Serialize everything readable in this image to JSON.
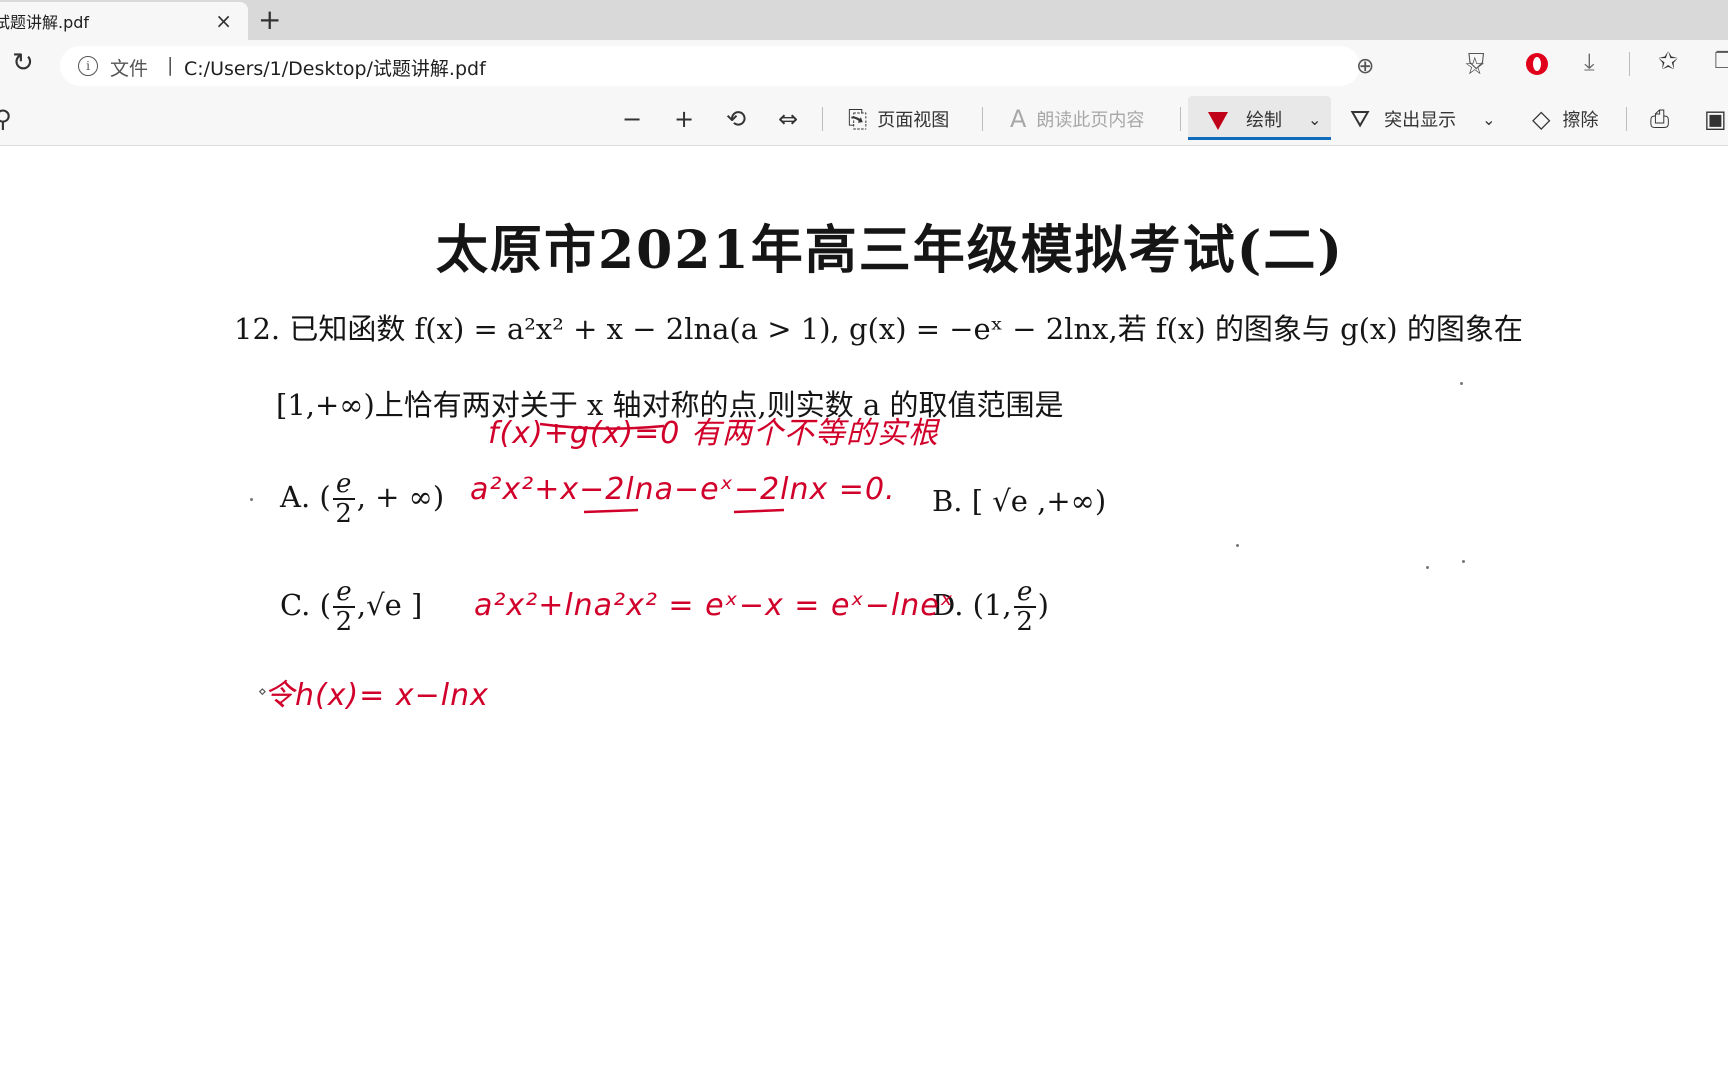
{
  "tab": {
    "title": "试题讲解.pdf",
    "close": "×",
    "new_tab": "+"
  },
  "address": {
    "site_label": "文件",
    "separator": "|",
    "url": "C:/Users/1/Desktop/试题讲解.pdf"
  },
  "toolbar": {
    "zoom_out": "−",
    "zoom_in": "+",
    "rotate": "⟲",
    "fit": "⇔",
    "page_view": "页面视图",
    "read_aloud": "朗读此页内容",
    "draw": "绘制",
    "highlight": "突出显示",
    "erase": "擦除",
    "chevron": "⌄"
  },
  "document": {
    "title": "太原市2021年高三年级模拟考试(二)",
    "question_line1": "12. 已知函数 f(x) = a²x² + x − 2lna(a > 1), g(x) = −eˣ − 2lnx,若 f(x) 的图象与 g(x) 的图象在",
    "question_line2": "[1,+∞)上恰有两对关于 x 轴对称的点,则实数 a 的取值范围是",
    "options": {
      "a_prefix": "A. (",
      "a_num": "e",
      "a_den": "2",
      "a_suffix": ", + ∞)",
      "b": "B. [ √e ,+∞)",
      "c_prefix": "C. (",
      "c_num": "e",
      "c_den": "2",
      "c_suffix": ",√e ]",
      "d_prefix": "D. (1,",
      "d_num": "e",
      "d_den": "2",
      "d_suffix": ")"
    },
    "handwriting": {
      "line1": "f(x)+g(x)=0  有两个不等的实根",
      "line2": "a²x²+x−2lna−eˣ−2lnx =0.",
      "line3": "a²x²+lna²x² = eˣ−x  = eˣ−lneˣ",
      "line4": "令h(x)= x−lnx"
    }
  }
}
